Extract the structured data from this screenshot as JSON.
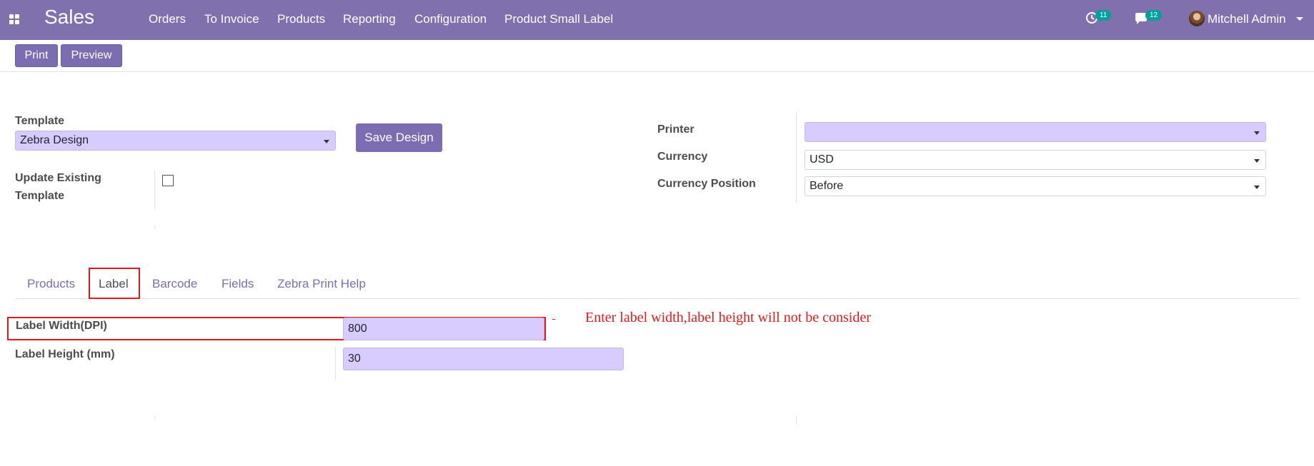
{
  "navbar": {
    "brand": "Sales",
    "menu": [
      "Orders",
      "To Invoice",
      "Products",
      "Reporting",
      "Configuration",
      "Product Small Label"
    ],
    "activity_count": "11",
    "messages_count": "12",
    "user_name": "Mitchell Admin",
    "bg_color": "#8070ae"
  },
  "control_panel": {
    "print_label": "Print",
    "preview_label": "Preview"
  },
  "form": {
    "template_label": "Template",
    "template_value": "Zebra Design",
    "save_design_label": "Save Design",
    "update_existing_label_1": "Update Existing",
    "update_existing_label_2": "Template",
    "update_existing_checked": false,
    "printer_label": "Printer",
    "printer_value": "",
    "currency_label": "Currency",
    "currency_value": "USD",
    "currency_position_label": "Currency Position",
    "currency_position_value": "Before"
  },
  "tabs": [
    {
      "label": "Products",
      "active": false
    },
    {
      "label": "Label",
      "active": true
    },
    {
      "label": "Barcode",
      "active": false
    },
    {
      "label": "Fields",
      "active": false
    },
    {
      "label": "Zebra Print Help",
      "active": false
    }
  ],
  "label_page": {
    "width_label": "Label Width(DPI)",
    "width_value": "800",
    "height_label": "Label Height (mm)",
    "height_value": "30",
    "annotation": "Enter label width,label height will not be consider"
  },
  "icons": {
    "apps": "apps-grid-icon",
    "activity": "clock-icon",
    "messages": "chat-bubble-icon",
    "user_menu": "caret-down-icon"
  }
}
